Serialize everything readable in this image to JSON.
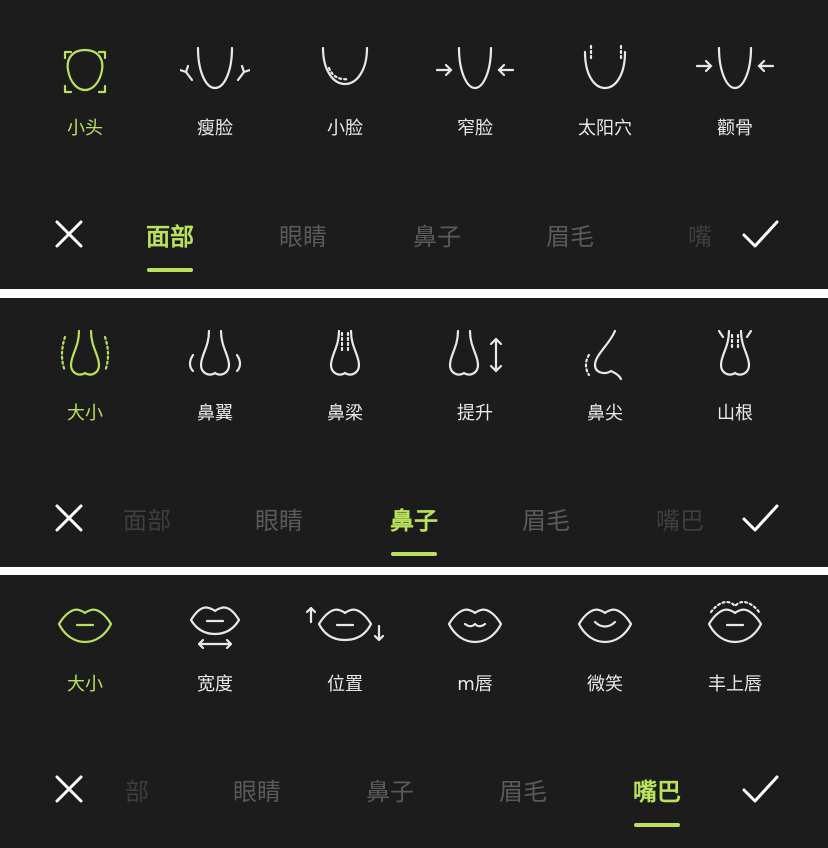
{
  "face_panel": {
    "options": [
      {
        "label": "小头",
        "icon": "small-head-icon",
        "active": true
      },
      {
        "label": "瘦脸",
        "icon": "slim-face-icon"
      },
      {
        "label": "小脸",
        "icon": "small-face-icon"
      },
      {
        "label": "窄脸",
        "icon": "narrow-face-icon"
      },
      {
        "label": "太阳穴",
        "icon": "temple-icon"
      },
      {
        "label": "颧骨",
        "icon": "cheekbone-icon"
      }
    ],
    "tabs": [
      "面部",
      "眼睛",
      "鼻子",
      "眉毛",
      "嘴巴"
    ],
    "active_tab": "面部"
  },
  "nose_panel": {
    "options": [
      {
        "label": "大小",
        "icon": "nose-size-icon",
        "active": true
      },
      {
        "label": "鼻翼",
        "icon": "nose-wing-icon"
      },
      {
        "label": "鼻梁",
        "icon": "nose-bridge-icon"
      },
      {
        "label": "提升",
        "icon": "nose-lift-icon"
      },
      {
        "label": "鼻尖",
        "icon": "nose-tip-icon"
      },
      {
        "label": "山根",
        "icon": "nose-root-icon"
      }
    ],
    "tabs": [
      "面部",
      "眼睛",
      "鼻子",
      "眉毛",
      "嘴巴"
    ],
    "active_tab": "鼻子"
  },
  "mouth_panel": {
    "options": [
      {
        "label": "大小",
        "icon": "lip-size-icon",
        "active": true
      },
      {
        "label": "宽度",
        "icon": "lip-width-icon"
      },
      {
        "label": "位置",
        "icon": "lip-position-icon"
      },
      {
        "label": "m唇",
        "icon": "m-lip-icon"
      },
      {
        "label": "微笑",
        "icon": "smile-icon"
      },
      {
        "label": "丰上唇",
        "icon": "plump-upper-lip-icon"
      }
    ],
    "tabs": [
      "部",
      "眼睛",
      "鼻子",
      "眉毛",
      "嘴巴"
    ],
    "active_tab": "嘴巴"
  },
  "colors": {
    "accent": "#b9e15a",
    "panel_bg": "#1c1c1c",
    "tab_inactive": "#5a5a5a",
    "icon": "#e8e8e8"
  },
  "controls": {
    "cancel_icon": "close-icon",
    "confirm_icon": "check-icon"
  }
}
